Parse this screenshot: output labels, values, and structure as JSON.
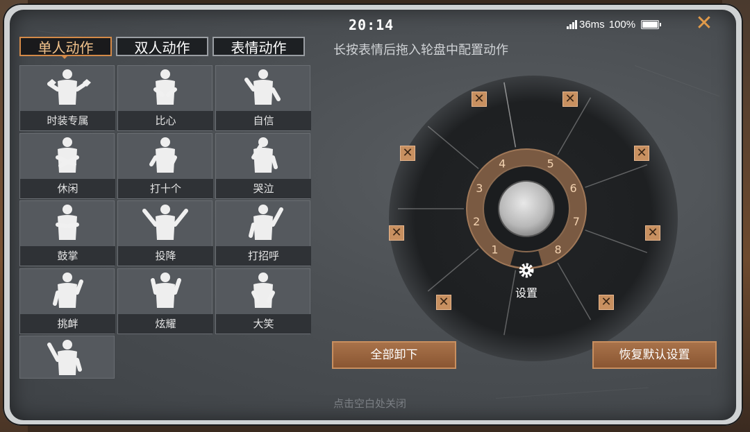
{
  "status_bar": {
    "time": "20:14",
    "ping": "36ms",
    "battery": "100%"
  },
  "close_glyph": "✕",
  "tabs": [
    {
      "label": "单人动作",
      "active": true
    },
    {
      "label": "双人动作",
      "active": false
    },
    {
      "label": "表情动作",
      "active": false
    }
  ],
  "hint": "长按表情后拖入轮盘中配置动作",
  "emotes": [
    {
      "label": "时装专属",
      "pose": "hearts"
    },
    {
      "label": "比心",
      "pose": "heart-hands"
    },
    {
      "label": "自信",
      "pose": "flex"
    },
    {
      "label": "休闲",
      "pose": "arms-crossed"
    },
    {
      "label": "打十个",
      "pose": "fight"
    },
    {
      "label": "哭泣",
      "pose": "cry"
    },
    {
      "label": "鼓掌",
      "pose": "clap"
    },
    {
      "label": "投降",
      "pose": "surrender"
    },
    {
      "label": "打招呼",
      "pose": "wave"
    },
    {
      "label": "挑衅",
      "pose": "taunt"
    },
    {
      "label": "炫耀",
      "pose": "show-off"
    },
    {
      "label": "大笑",
      "pose": "laugh"
    },
    {
      "label": "",
      "pose": "hi"
    }
  ],
  "wheel": {
    "slot_numbers": [
      "1",
      "2",
      "3",
      "4",
      "5",
      "6",
      "7",
      "8"
    ],
    "settings_label": "设置",
    "remove_glyph": "✕"
  },
  "buttons": {
    "unload_all": "全部卸下",
    "restore_default": "恢复默认设置"
  },
  "footer": "点击空白处关闭",
  "colors": {
    "accent": "#d48a48",
    "button": "#9a6340",
    "panel": "#4b4f53"
  }
}
